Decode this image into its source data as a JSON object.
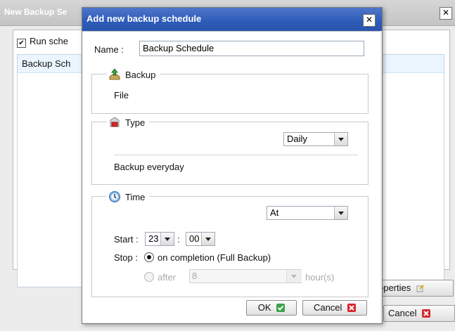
{
  "background_window": {
    "title": "New Backup Se",
    "close_glyph": "✕",
    "run_schedule_label": "Run sche",
    "list_item": "Backup Sch",
    "properties_button": "operties",
    "cancel_button": "Cancel"
  },
  "dialog": {
    "title": "Add new backup schedule",
    "close_glyph": "✕",
    "name_label": "Name :",
    "name_value": "Backup Schedule",
    "backup_group": {
      "legend": "Backup",
      "text": "File",
      "icon": "backup-upload-icon"
    },
    "type_group": {
      "legend": "Type",
      "icon": "type-shape-icon",
      "selected": "Daily",
      "description": "Backup everyday"
    },
    "time_group": {
      "legend": "Time",
      "icon": "clock-icon",
      "mode": "At",
      "start_label": "Start :",
      "start_hour": "23",
      "start_minute": "00",
      "colon": ":",
      "stop_label": "Stop :",
      "stop_option_completion": "on completion (Full Backup)",
      "stop_option_after": "after",
      "after_value": "8",
      "hours_label": "hour(s)"
    },
    "ok_button": "OK",
    "cancel_button": "Cancel"
  },
  "colors": {
    "title_bar": "#2d5bb8",
    "ok_icon": "#3aa34a",
    "cancel_icon": "#d6262c",
    "list_selection": "#eaf5ff"
  }
}
